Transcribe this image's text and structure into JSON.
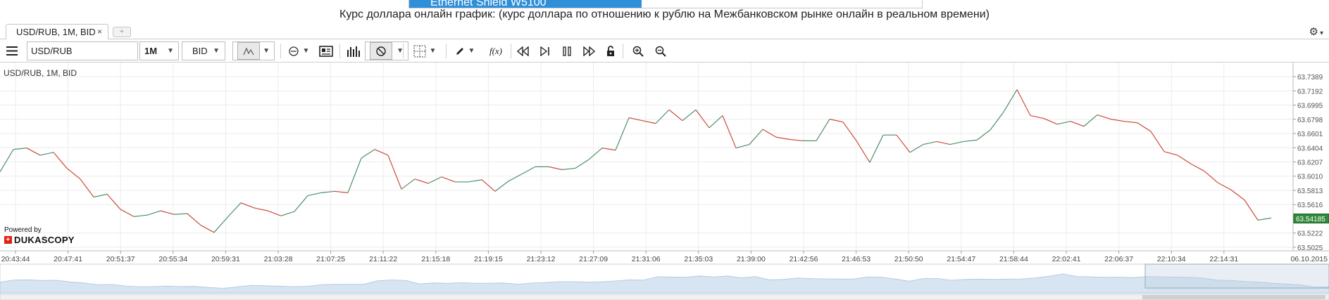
{
  "banner": {
    "text": "Ethernet Shield W5100"
  },
  "page_title": "Курс доллара онлайн график: (курс доллара по отношению к рублю на Межбанковском рынке онлайн в реальном времени)",
  "tab": {
    "label": "USD/RUB, 1M, BID",
    "close": "×",
    "add": "+"
  },
  "toolbar": {
    "symbol_value": "USD/RUB",
    "period": "1M",
    "price_side": "BID",
    "icons": [
      "menu-icon",
      "line-chart-icon",
      "ohlc-icon",
      "news-icon",
      "volume-icon",
      "no-cursor-icon",
      "grid-icon",
      "pen-icon",
      "function-icon",
      "rewind-icon",
      "step-icon",
      "pause-icon",
      "fast-forward-icon",
      "lock-icon",
      "zoom-in-icon",
      "zoom-out-icon"
    ],
    "function_label": "f(x)"
  },
  "settings_icon": "gear-icon",
  "chart_label": "USD/RUB, 1M, BID",
  "powered_by": "Powered by",
  "brand": "DUKASCOPY",
  "colors": {
    "up": "#4f8f6b",
    "down": "#cd4a3c",
    "grid": "#ececec",
    "price_tag": "#2f8a3a",
    "navigator": "#d7e5f2"
  },
  "chart_data": {
    "type": "line",
    "title": "USD/RUB, 1M, BID",
    "xlabel": "",
    "ylabel": "",
    "x_ticks": [
      "20:43:44",
      "20:47:41",
      "20:51:37",
      "20:55:34",
      "20:59:31",
      "21:03:28",
      "21:07:25",
      "21:11:22",
      "21:15:18",
      "21:19:15",
      "21:23:12",
      "21:27:09",
      "21:31:06",
      "21:35:03",
      "21:39:00",
      "21:42:56",
      "21:46:53",
      "21:50:50",
      "21:54:47",
      "21:58:44",
      "22:02:41",
      "22:06:37",
      "22:10:34",
      "22:14:31"
    ],
    "x_end_label": "06.10.2015",
    "y_ticks": [
      "63.7389",
      "63.7192",
      "63.6995",
      "63.6798",
      "63.6601",
      "63.6404",
      "63.6207",
      "63.6010",
      "63.5813",
      "63.5616",
      "63.5222",
      "63.5025"
    ],
    "ylim": [
      63.4975,
      63.7585
    ],
    "current_price": "63.54185",
    "grid": true,
    "values": [
      63.607,
      63.638,
      63.64,
      63.63,
      63.634,
      63.612,
      63.597,
      63.572,
      63.576,
      63.555,
      63.545,
      63.547,
      63.553,
      63.548,
      63.549,
      63.533,
      63.523,
      63.544,
      63.564,
      63.557,
      63.553,
      63.546,
      63.552,
      63.574,
      63.578,
      63.58,
      63.578,
      63.626,
      63.638,
      63.63,
      63.583,
      63.597,
      63.591,
      63.6,
      63.593,
      63.593,
      63.596,
      63.58,
      63.594,
      63.604,
      63.614,
      63.614,
      63.61,
      63.612,
      63.624,
      63.64,
      63.637,
      63.682,
      63.678,
      63.674,
      63.693,
      63.678,
      63.693,
      63.668,
      63.685,
      63.64,
      63.645,
      63.666,
      63.655,
      63.652,
      63.65,
      63.65,
      63.68,
      63.676,
      63.65,
      63.62,
      63.658,
      63.658,
      63.634,
      63.645,
      63.649,
      63.645,
      63.649,
      63.651,
      63.665,
      63.69,
      63.721,
      63.685,
      63.681,
      63.673,
      63.677,
      63.67,
      63.686,
      63.68,
      63.677,
      63.675,
      63.663,
      63.635,
      63.63,
      63.618,
      63.608,
      63.592,
      63.582,
      63.568,
      63.54,
      63.543
    ]
  }
}
